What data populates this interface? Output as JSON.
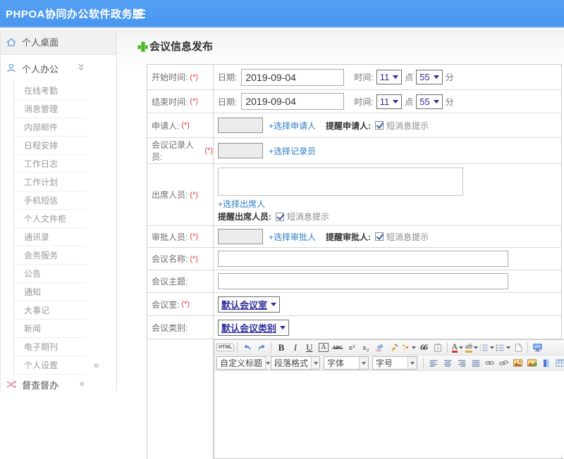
{
  "topbar": {
    "title": "PHPOA协同办公软件政务版"
  },
  "sidebar": {
    "desktop": "个人桌面",
    "office": "个人办公",
    "office_sub": [
      "在线考勤",
      "消息管理",
      "内部邮件",
      "日程安排",
      "工作日志",
      "工作计划",
      "手机短信",
      "个人文件柜",
      "通讯录",
      "会务服务",
      "公告",
      "通知",
      "大事记",
      "新闻",
      "电子期刊"
    ],
    "settings": "个人设置",
    "settings_chevron": "»",
    "supervision": "督查督办",
    "supervision_chevron": "»"
  },
  "page": {
    "title": "会议信息发布"
  },
  "form": {
    "start_time": {
      "label": "开始时间:",
      "req": "(*)",
      "date_label": "日期:",
      "date_value": "2019-09-04",
      "time_label": "时间:",
      "hour": "11",
      "hour_suffix": "点",
      "minute": "55",
      "minute_suffix": "分"
    },
    "end_time": {
      "label": "结束时间:",
      "req": "(*)",
      "date_label": "日期:",
      "date_value": "2019-09-04",
      "time_label": "时间:",
      "hour": "11",
      "hour_suffix": "点",
      "minute": "55",
      "minute_suffix": "分"
    },
    "applicant": {
      "label": "申请人:",
      "req": "(*)",
      "link": "+选择申请人",
      "remind_label": "提醒申请人:",
      "sms": "短消息提示"
    },
    "recorder": {
      "label": "会议记录人员:",
      "req": "(*)",
      "link": "+选择记录员"
    },
    "attendees": {
      "label": "出席人员:",
      "req": "(*)",
      "link": "+选择出席人",
      "remind_label": "提醒出席人员:",
      "sms": "短消息提示"
    },
    "approver": {
      "label": "审批人员:",
      "req": "(*)",
      "link": "+选择审批人",
      "remind_label": "提醒审批人:",
      "sms": "短消息提示"
    },
    "meeting_name": {
      "label": "会议名称:",
      "req": "(*)"
    },
    "meeting_topic": {
      "label": "会议主题:"
    },
    "meeting_room": {
      "label": "会议室:",
      "req": "(*)",
      "value": "默认会议室"
    },
    "meeting_category": {
      "label": "会议类别:",
      "value": "默认会议类别"
    }
  },
  "editor": {
    "html": "HTML",
    "bold": "B",
    "italic": "I",
    "underline": "U",
    "font_box": "A",
    "strike": "ABC",
    "sup": "x²",
    "sub": "x₂",
    "quote": "66",
    "font_color": "A",
    "highlight": "ab",
    "combos": {
      "heading": "自定义标题",
      "paragraph": "段落格式",
      "font": "字体",
      "size": "字号"
    }
  },
  "colors": {
    "accent": "#4896ef",
    "link": "#2d7dc6",
    "select_text": "#2d2d9c",
    "required": "#e83a3a"
  }
}
